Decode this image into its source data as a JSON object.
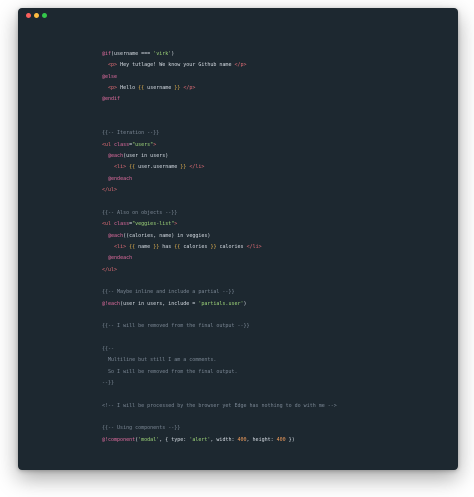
{
  "window": {
    "controls": [
      "close-button",
      "minimize-button",
      "zoom-button"
    ]
  },
  "code": {
    "lines": [
      [
        {
          "c": "k",
          "t": "@if"
        },
        {
          "c": "v",
          "t": "(username === "
        },
        {
          "c": "s",
          "t": "'virk'"
        },
        {
          "c": "v",
          "t": ")"
        }
      ],
      [
        {
          "c": "v",
          "t": "  "
        },
        {
          "c": "t",
          "t": "<p>"
        },
        {
          "c": "v",
          "t": " Hey tutlage! We know your Github name "
        },
        {
          "c": "t",
          "t": "</p>"
        }
      ],
      [
        {
          "c": "k",
          "t": "@else"
        }
      ],
      [
        {
          "c": "v",
          "t": "  "
        },
        {
          "c": "t",
          "t": "<p>"
        },
        {
          "c": "v",
          "t": " Hello "
        },
        {
          "c": "b",
          "t": "{{"
        },
        {
          "c": "v",
          "t": " username "
        },
        {
          "c": "b",
          "t": "}}"
        },
        {
          "c": "v",
          "t": " "
        },
        {
          "c": "t",
          "t": "</p>"
        }
      ],
      [
        {
          "c": "k",
          "t": "@endif"
        }
      ],
      [],
      [],
      [
        {
          "c": "cm",
          "t": "{{-- Iteration --}}"
        }
      ],
      [
        {
          "c": "t",
          "t": "<ul"
        },
        {
          "c": "v",
          "t": " "
        },
        {
          "c": "k",
          "t": "class"
        },
        {
          "c": "v",
          "t": "="
        },
        {
          "c": "s",
          "t": "\"users\""
        },
        {
          "c": "t",
          "t": ">"
        }
      ],
      [
        {
          "c": "v",
          "t": "  "
        },
        {
          "c": "k",
          "t": "@each"
        },
        {
          "c": "v",
          "t": "(user in users)"
        }
      ],
      [
        {
          "c": "v",
          "t": "    "
        },
        {
          "c": "t",
          "t": "<li>"
        },
        {
          "c": "v",
          "t": " "
        },
        {
          "c": "b",
          "t": "{{"
        },
        {
          "c": "v",
          "t": " user.username "
        },
        {
          "c": "b",
          "t": "}}"
        },
        {
          "c": "v",
          "t": " "
        },
        {
          "c": "t",
          "t": "</li>"
        }
      ],
      [
        {
          "c": "v",
          "t": "  "
        },
        {
          "c": "k",
          "t": "@endeach"
        }
      ],
      [
        {
          "c": "t",
          "t": "</ul>"
        }
      ],
      [],
      [
        {
          "c": "cm",
          "t": "{{-- Also on objects --}}"
        }
      ],
      [
        {
          "c": "t",
          "t": "<ul"
        },
        {
          "c": "v",
          "t": " "
        },
        {
          "c": "k",
          "t": "class"
        },
        {
          "c": "v",
          "t": "="
        },
        {
          "c": "s",
          "t": "\"veggies-list\""
        },
        {
          "c": "t",
          "t": ">"
        }
      ],
      [
        {
          "c": "v",
          "t": "  "
        },
        {
          "c": "k",
          "t": "@each"
        },
        {
          "c": "v",
          "t": "((calories, name) in veggies)"
        }
      ],
      [
        {
          "c": "v",
          "t": "    "
        },
        {
          "c": "t",
          "t": "<li>"
        },
        {
          "c": "v",
          "t": " "
        },
        {
          "c": "b",
          "t": "{{"
        },
        {
          "c": "v",
          "t": " name "
        },
        {
          "c": "b",
          "t": "}}"
        },
        {
          "c": "v",
          "t": " has "
        },
        {
          "c": "b",
          "t": "{{"
        },
        {
          "c": "v",
          "t": " calories "
        },
        {
          "c": "b",
          "t": "}}"
        },
        {
          "c": "v",
          "t": " calories "
        },
        {
          "c": "t",
          "t": "</li>"
        }
      ],
      [
        {
          "c": "v",
          "t": "  "
        },
        {
          "c": "k",
          "t": "@endeach"
        }
      ],
      [
        {
          "c": "t",
          "t": "</ul>"
        }
      ],
      [],
      [
        {
          "c": "cm",
          "t": "{{-- Maybe inline and include a partial --}}"
        }
      ],
      [
        {
          "c": "k",
          "t": "@!each"
        },
        {
          "c": "v",
          "t": "(user in users, include = "
        },
        {
          "c": "s",
          "t": "'partials.user'"
        },
        {
          "c": "v",
          "t": ")"
        }
      ],
      [],
      [
        {
          "c": "cm",
          "t": "{{-- I will be removed from the final output --}}"
        }
      ],
      [],
      [
        {
          "c": "cm",
          "t": "{{--"
        }
      ],
      [
        {
          "c": "cm",
          "t": "  Multiline but still I am a comments."
        }
      ],
      [
        {
          "c": "cm",
          "t": "  So I will be removed from the final output."
        }
      ],
      [
        {
          "c": "cm",
          "t": "--}}"
        }
      ],
      [],
      [
        {
          "c": "cm",
          "t": "<!-- I will be processed by the browser yet Edge has nothing to do with me -->"
        }
      ],
      [],
      [
        {
          "c": "cm",
          "t": "{{-- Using components --}}"
        }
      ],
      [
        {
          "c": "k",
          "t": "@!component"
        },
        {
          "c": "v",
          "t": "("
        },
        {
          "c": "s",
          "t": "'modal'"
        },
        {
          "c": "v",
          "t": ", { type: "
        },
        {
          "c": "s",
          "t": "'alert'"
        },
        {
          "c": "v",
          "t": ", width: "
        },
        {
          "c": "n",
          "t": "400"
        },
        {
          "c": "v",
          "t": ", height: "
        },
        {
          "c": "n",
          "t": "400"
        },
        {
          "c": "v",
          "t": " })"
        }
      ]
    ]
  }
}
